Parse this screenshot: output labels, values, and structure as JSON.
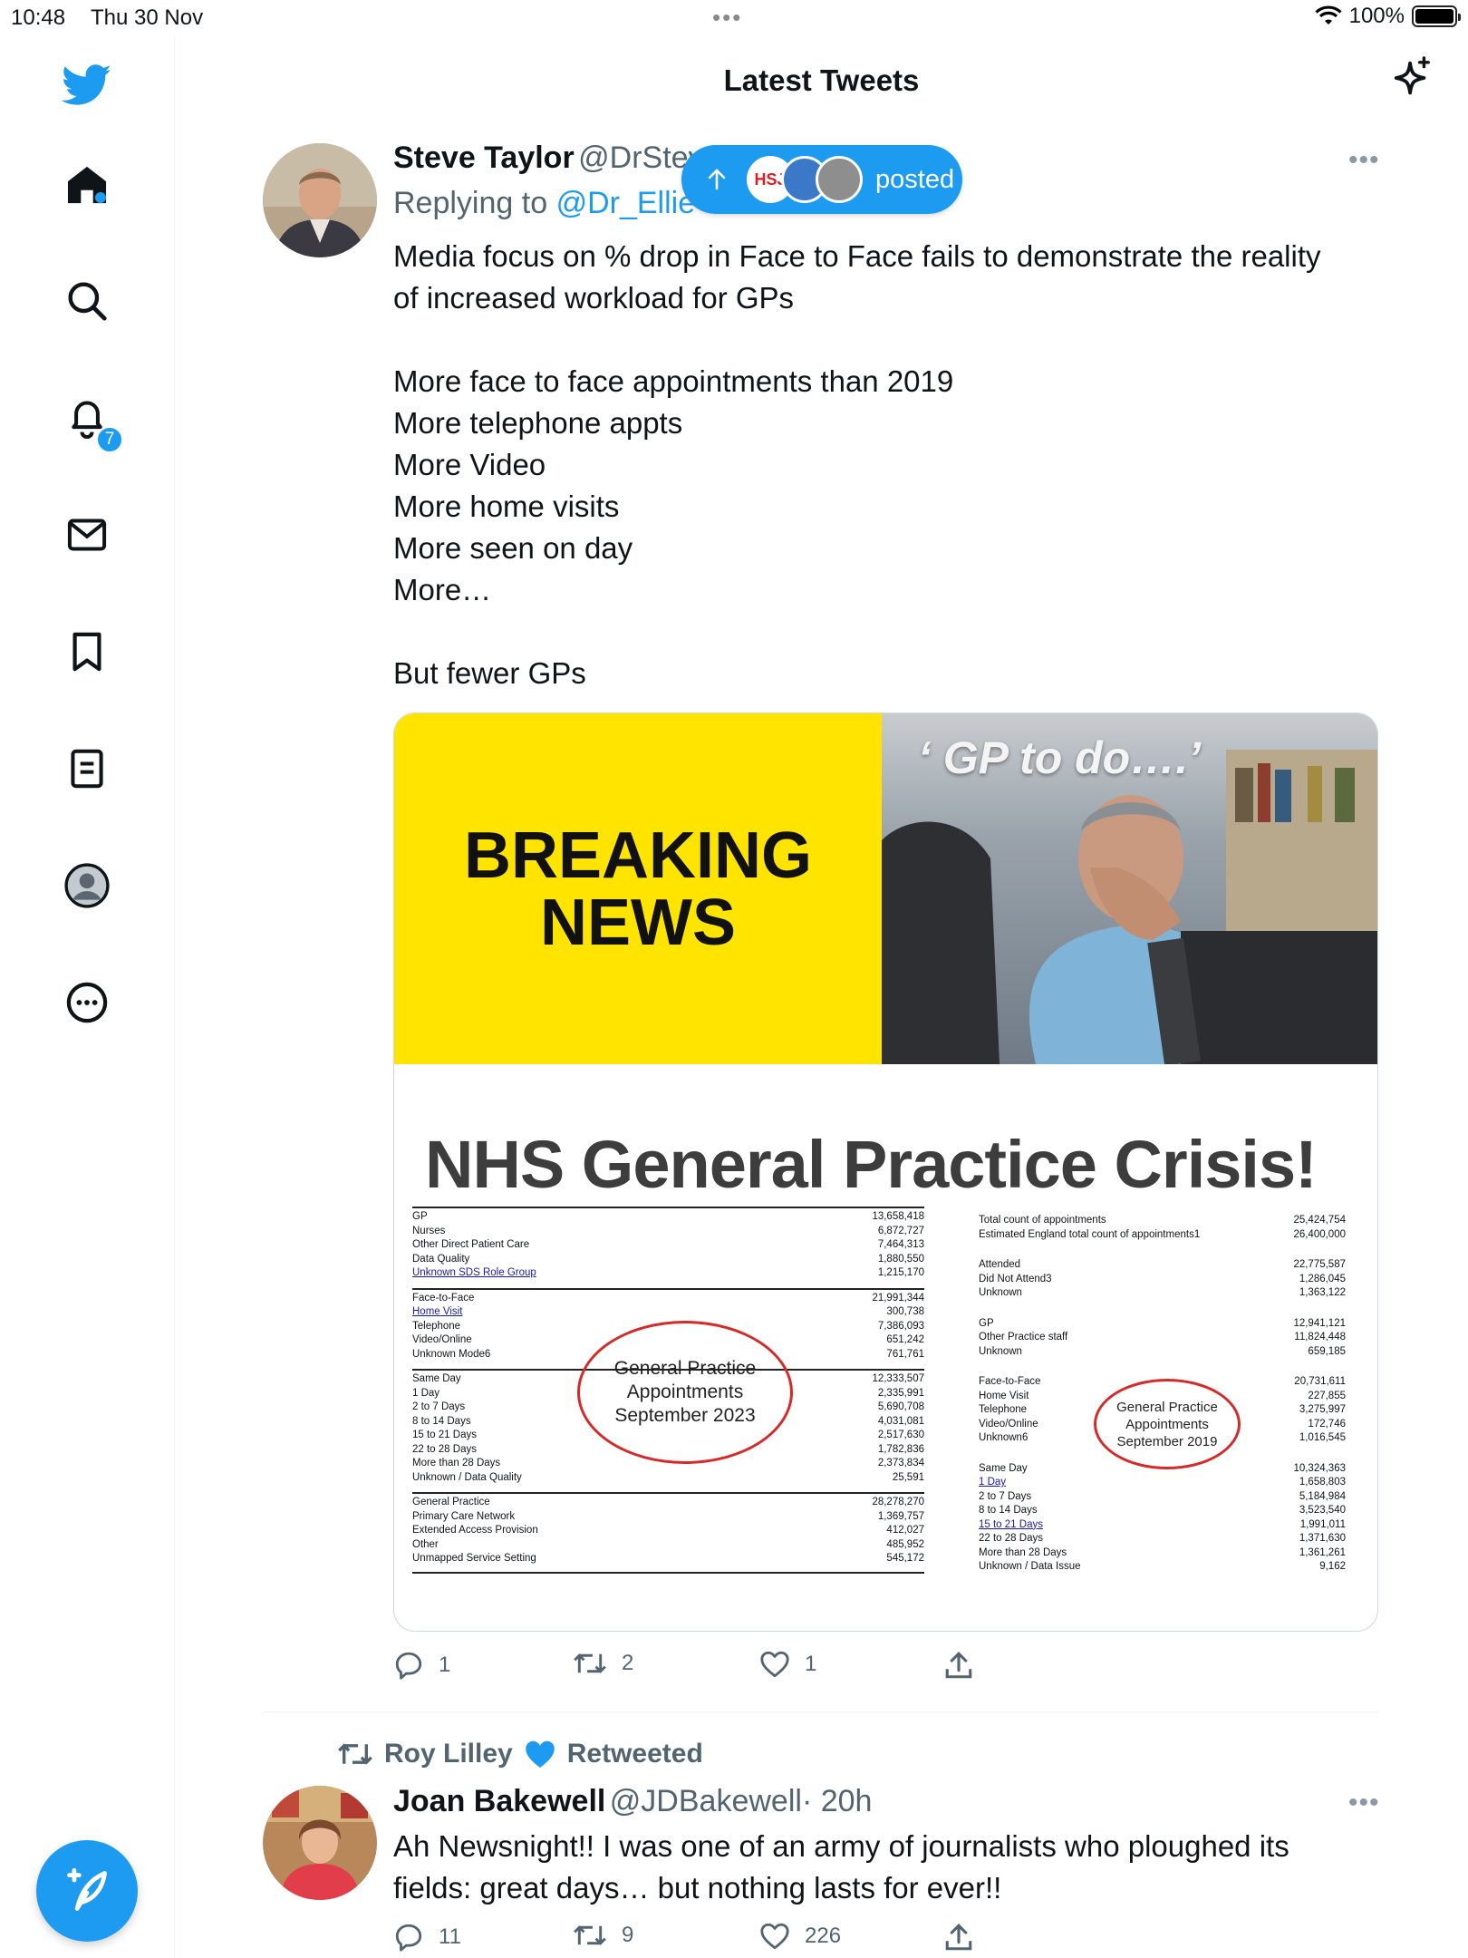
{
  "status_bar": {
    "time": "10:48",
    "date": "Thu 30 Nov",
    "battery": "100%"
  },
  "header": {
    "title": "Latest Tweets"
  },
  "sidebar": {
    "notifications_badge": "7"
  },
  "tweet1": {
    "author_name": "Steve Taylor",
    "author_handle": "@DrStev",
    "replying_prefix": "Replying to",
    "replying_handle": "@Dr_Ellie",
    "posted_pill": {
      "label": "posted",
      "logo_text": "HSJ"
    },
    "text_lines": [
      "Media focus on % drop in Face to Face fails to demonstrate the reality",
      "of increased workload for GPs",
      "",
      "More face to face appointments than 2019",
      "More telephone appts",
      "More Video",
      "More home visits",
      "More seen on day",
      "More…",
      "",
      "But fewer GPs"
    ],
    "media": {
      "breaking_line1": "BREAKING",
      "breaking_line2": "NEWS",
      "photo_caption": "‘ GP to do….’",
      "title": "NHS General Practice Crisis!",
      "oval_2023": [
        "General Practice",
        "Appointments",
        "September 2023"
      ],
      "oval_2019": [
        "General Practice",
        "Appointments",
        "September 2019"
      ],
      "table_2023": [
        [
          [
            "GP",
            "13,658,418"
          ],
          [
            "Nurses",
            "6,872,727"
          ],
          [
            "Other Direct Patient Care",
            "7,464,313"
          ],
          [
            "Data Quality",
            "1,880,550"
          ],
          [
            "Unknown SDS Role Group",
            "1,215,170"
          ]
        ],
        [
          [
            "Face-to-Face",
            "21,991,344"
          ],
          [
            "Home Visit",
            "300,738"
          ],
          [
            "Telephone",
            "7,386,093"
          ],
          [
            "Video/Online",
            "651,242"
          ],
          [
            "Unknown Mode6",
            "761,761"
          ]
        ],
        [
          [
            "Same Day",
            "12,333,507"
          ],
          [
            "1 Day",
            "2,335,991"
          ],
          [
            "2 to 7 Days",
            "5,690,708"
          ],
          [
            "8  to 14 Days",
            "4,031,081"
          ],
          [
            "15  to 21 Days",
            "2,517,630"
          ],
          [
            "22  to 28 Days",
            "1,782,836"
          ],
          [
            "More than 28 Days",
            "2,373,834"
          ],
          [
            "Unknown / Data Quality",
            "25,591"
          ]
        ],
        [
          [
            "General Practice",
            "28,278,270"
          ],
          [
            "Primary Care Network",
            "1,369,757"
          ],
          [
            "Extended Access Provision",
            "412,027"
          ],
          [
            "Other",
            "485,952"
          ],
          [
            "Unmapped Service Setting",
            "545,172"
          ]
        ]
      ],
      "table_2019": [
        [
          [
            "Total count of appointments",
            "25,424,754"
          ],
          [
            "Estimated England total count of appointments1",
            "26,400,000"
          ]
        ],
        [
          [
            "Attended",
            "22,775,587"
          ],
          [
            "Did Not Attend3",
            "1,286,045"
          ],
          [
            "Unknown",
            "1,363,122"
          ]
        ],
        [
          [
            "GP",
            "12,941,121"
          ],
          [
            "Other Practice staff",
            "11,824,448"
          ],
          [
            "Unknown",
            "659,185"
          ]
        ],
        [
          [
            "Face-to-Face",
            "20,731,611"
          ],
          [
            "Home Visit",
            "227,855"
          ],
          [
            "Telephone",
            "3,275,997"
          ],
          [
            "Video/Online",
            "172,746"
          ],
          [
            "Unknown6",
            "1,016,545"
          ]
        ],
        [
          [
            "Same Day",
            "10,324,363"
          ],
          [
            "1 Day",
            "1,658,803"
          ],
          [
            "2 to 7 Days",
            "5,184,984"
          ],
          [
            "8  to 14 Days",
            "3,523,540"
          ],
          [
            "15  to 21 Days",
            "1,991,011"
          ],
          [
            "22  to 28 Days",
            "1,371,630"
          ],
          [
            "More than 28 Days",
            "1,361,261"
          ],
          [
            "Unknown / Data Issue",
            "9,162"
          ]
        ]
      ]
    },
    "stats": {
      "replies": "1",
      "retweets": "2",
      "likes": "1"
    }
  },
  "tweet2": {
    "retweeted_by": "Roy Lilley",
    "retweeted_label": "Retweeted",
    "author_name": "Joan Bakewell",
    "author_handle": "@JDBakewell",
    "time": "· 20h",
    "text_lines": [
      "Ah Newsnight!!  I was one of an army of journalists who ploughed its",
      "fields: great days… but nothing lasts for ever!!"
    ],
    "stats": {
      "replies": "11",
      "retweets": "9",
      "likes": "226"
    }
  },
  "icons": [
    "twitter-logo-icon",
    "home-icon",
    "search-icon",
    "bell-icon",
    "mail-icon",
    "bookmark-icon",
    "lists-icon",
    "profile-icon",
    "more-circle-icon",
    "compose-icon",
    "sparkle-icon",
    "reply-icon",
    "retweet-icon",
    "heart-icon",
    "share-icon",
    "wifi-icon",
    "battery-icon"
  ],
  "colors": {
    "accent": "#1d9bf0",
    "secondary_text": "#536471",
    "breaking_yellow": "#ffe400",
    "oval_red": "#d42a2a"
  }
}
